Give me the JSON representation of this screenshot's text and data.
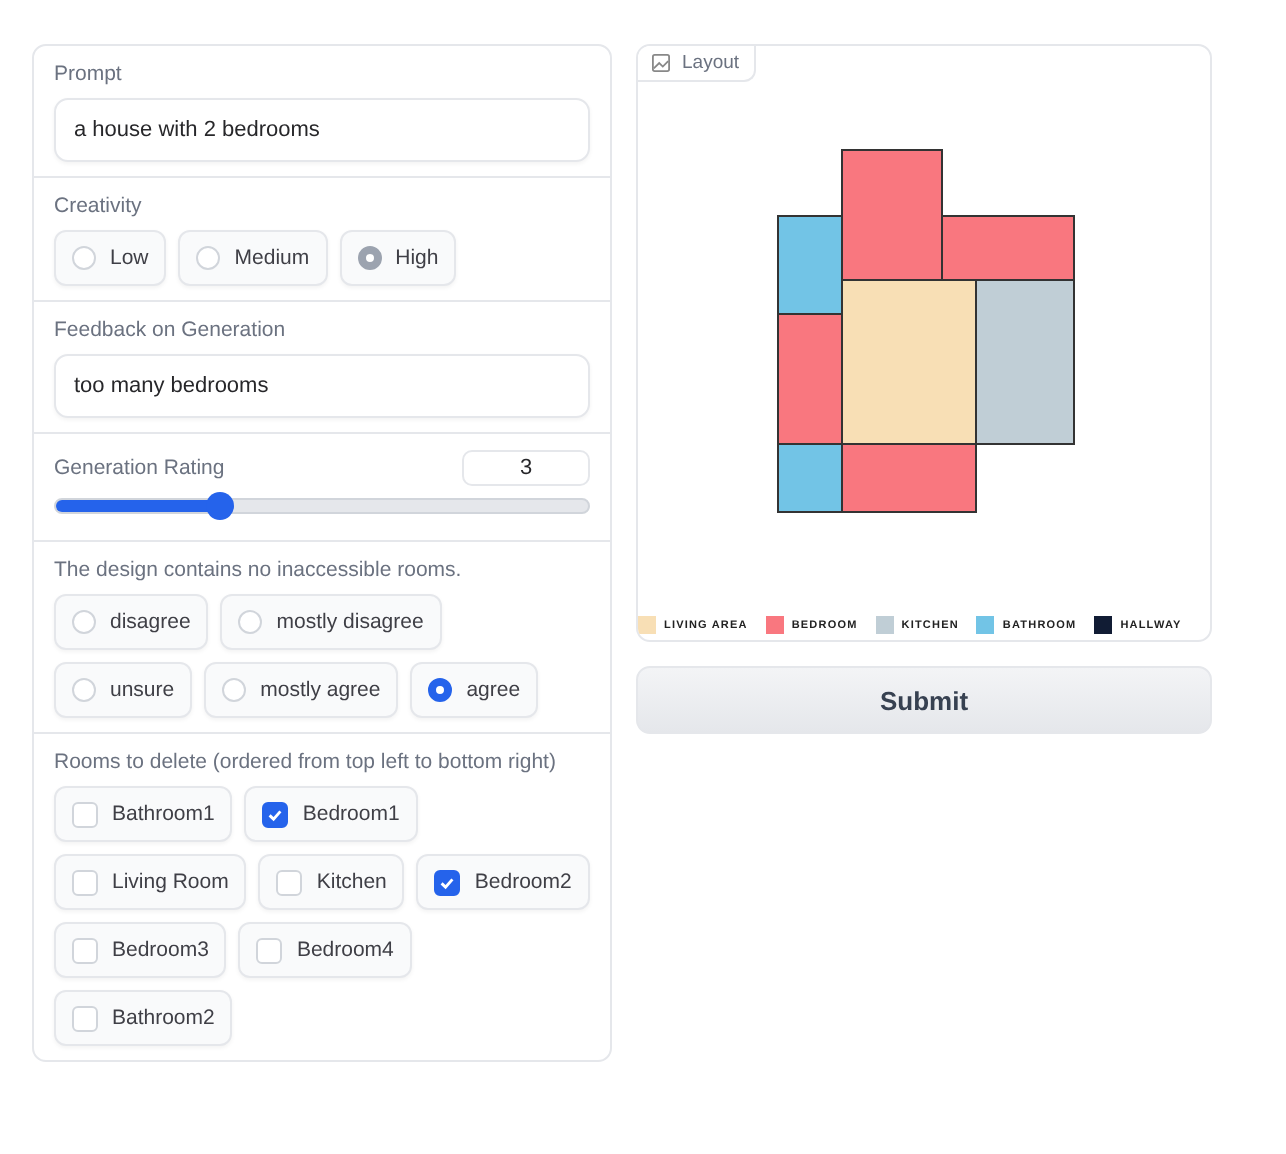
{
  "prompt": {
    "label": "Prompt",
    "value": "a house with 2 bedrooms"
  },
  "creativity": {
    "label": "Creativity",
    "options": [
      {
        "label": "Low",
        "selected": false
      },
      {
        "label": "Medium",
        "selected": false
      },
      {
        "label": "High",
        "selected": true
      }
    ]
  },
  "feedback": {
    "label": "Feedback on Generation",
    "value": "too many bedrooms"
  },
  "rating": {
    "label": "Generation Rating",
    "value": "3",
    "level": 0.31
  },
  "accessibility": {
    "label": "The design contains no inaccessible rooms.",
    "options": [
      {
        "label": "disagree",
        "selected": false
      },
      {
        "label": "mostly disagree",
        "selected": false
      },
      {
        "label": "unsure",
        "selected": false
      },
      {
        "label": "mostly agree",
        "selected": false
      },
      {
        "label": "agree",
        "selected": true
      }
    ]
  },
  "rooms_to_delete": {
    "label": "Rooms to delete (ordered from top left to bottom right)",
    "options": [
      {
        "label": "Bathroom1",
        "checked": false
      },
      {
        "label": "Bedroom1",
        "checked": true
      },
      {
        "label": "Living Room",
        "checked": false
      },
      {
        "label": "Kitchen",
        "checked": false
      },
      {
        "label": "Bedroom2",
        "checked": true
      },
      {
        "label": "Bedroom3",
        "checked": false
      },
      {
        "label": "Bedroom4",
        "checked": false
      },
      {
        "label": "Bathroom2",
        "checked": false
      }
    ]
  },
  "layout": {
    "label": "Layout",
    "legend": [
      {
        "label": "LIVING AREA",
        "color": "#f8dfb5"
      },
      {
        "label": "BEDROOM",
        "color": "#f9777f"
      },
      {
        "label": "KITCHEN",
        "color": "#c0ced6"
      },
      {
        "label": "BATHROOM",
        "color": "#72c4e6"
      },
      {
        "label": "HALLWAY",
        "color": "#111c34"
      }
    ]
  },
  "submit": {
    "label": "Submit"
  }
}
